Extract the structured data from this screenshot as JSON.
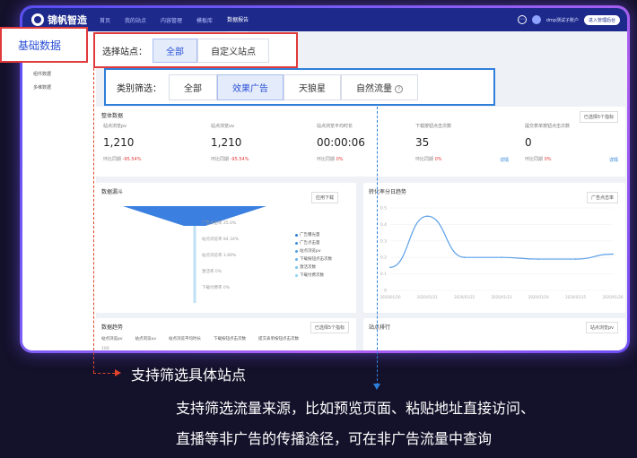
{
  "topnav": {
    "logo": "锦帆智造",
    "items": [
      "首页",
      "我的站点",
      "内容管理",
      "模板库",
      "数据报告"
    ],
    "active_index": 4,
    "user": "dmp测试子账户",
    "action": "进入管理后台"
  },
  "sidebar": {
    "main_item": "基础数据",
    "items": [
      "组件数据",
      "多维数据"
    ]
  },
  "site_filter": {
    "label": "选择站点：",
    "options": [
      "全部",
      "自定义站点"
    ],
    "selected": "全部"
  },
  "category_filter": {
    "label": "类别筛选：",
    "options": [
      "全部",
      "效果广告",
      "天狼星",
      "自然流量"
    ],
    "selected": "效果广告"
  },
  "overview": {
    "title": "整体数据",
    "select": "已选择5个指标",
    "stats": [
      {
        "label": "站点浏览pv",
        "value": "1,210",
        "comp_label": "环比同期",
        "comp": "-95.54%"
      },
      {
        "label": "站点浏览uv",
        "value": "1,210",
        "comp_label": "环比同期",
        "comp": "-95.54%"
      },
      {
        "label": "站点浏览平均时长",
        "value": "00:00:06",
        "comp_label": "环比同期",
        "comp": "0%"
      },
      {
        "label": "下载按钮点击次数",
        "value": "35",
        "comp_label": "环比同期",
        "comp": "0%"
      },
      {
        "label": "提交表单按钮点击次数",
        "value": "0",
        "comp_label": "环比同期",
        "comp": "0%"
      }
    ],
    "detail": "详情"
  },
  "funnel": {
    "title": "数据漏斗",
    "select": "应用下载",
    "stages": [
      "广告点击率 25.0%",
      "站点浏览率 84.34%",
      "站点浏览率 3.89%",
      "激活率 0%",
      "下载付费率 0%"
    ],
    "legend": [
      "广告曝光量",
      "广告点击量",
      "站点浏览pv",
      "下载按钮点击次数",
      "激活次数",
      "下载付费次数"
    ],
    "legend_colors": [
      "#2a7fd6",
      "#3d8ee0",
      "#4fa0e6",
      "#62b2ea",
      "#76c3ee",
      "#8bd3f1"
    ]
  },
  "trend": {
    "title": "转化率分日趋势",
    "select": "广告点击率",
    "y_ticks": [
      "0.5",
      "0.4",
      "0.3",
      "0.2",
      "0.1",
      "0"
    ]
  },
  "data_trend": {
    "title": "数据趋势",
    "select": "已选择5个指标",
    "legend": [
      "站点浏览pv",
      "站点浏览uv",
      "站点浏览平均时长",
      "下载按钮点击次数",
      "提交表单按钮点击次数"
    ],
    "y_top": "100"
  },
  "rank": {
    "title": "站点排行",
    "select": "站点浏览pv"
  },
  "chart_data": {
    "type": "line",
    "title": "转化率分日趋势",
    "x": [
      "2020/01/20",
      "2020/01/21",
      "2020/01/22",
      "2020/01/23",
      "2020/01/24",
      "2020/01/25",
      "2020/01/26"
    ],
    "series": [
      {
        "name": "广告点击率",
        "values": [
          0.14,
          0.45,
          0.2,
          0.2,
          0.19,
          0.19,
          0.22
        ]
      }
    ],
    "ylim": [
      0,
      0.5
    ],
    "grid": true
  },
  "captions": {
    "red": "支持筛选具体站点",
    "blue_line1": "支持筛选流量来源，比如预览页面、粘贴地址直接访问、",
    "blue_line2": "直播等非广告的传播途径，可在非广告流量中查询"
  },
  "colors": {
    "red_box": "#e03a3a",
    "blue_box": "#2f7fd8",
    "nav_bg": "#1d2a8c",
    "line": "#5b9fe8"
  }
}
